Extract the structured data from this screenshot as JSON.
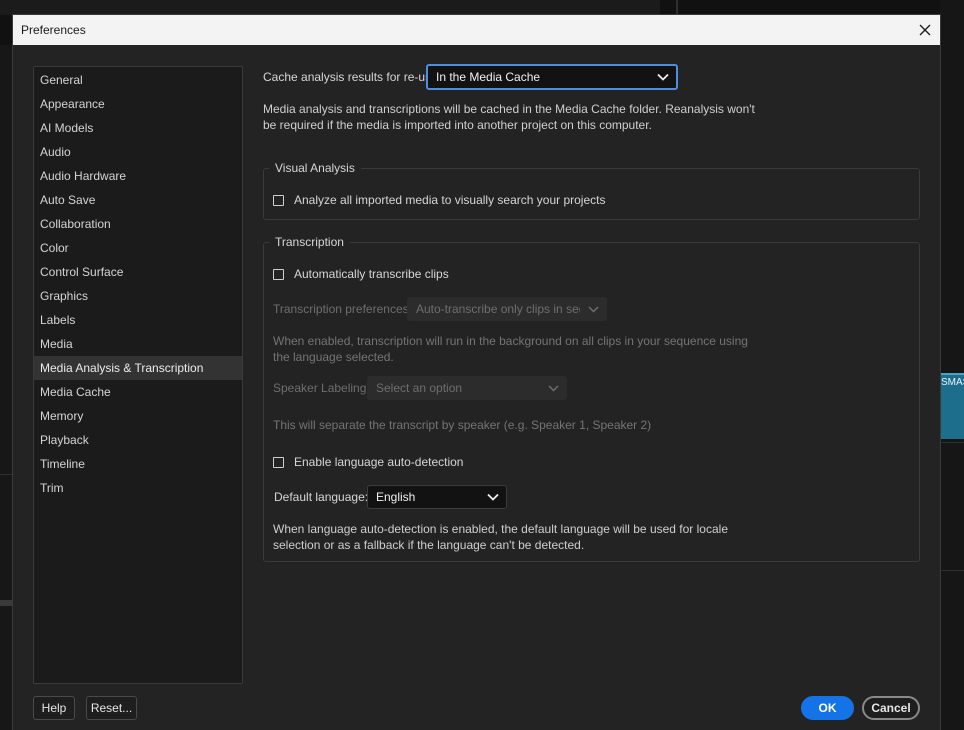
{
  "dialog": {
    "title": "Preferences"
  },
  "sidebar": {
    "items": [
      {
        "label": "General"
      },
      {
        "label": "Appearance"
      },
      {
        "label": "AI Models"
      },
      {
        "label": "Audio"
      },
      {
        "label": "Audio Hardware"
      },
      {
        "label": "Auto Save"
      },
      {
        "label": "Collaboration"
      },
      {
        "label": "Color"
      },
      {
        "label": "Control Surface"
      },
      {
        "label": "Graphics"
      },
      {
        "label": "Labels"
      },
      {
        "label": "Media"
      },
      {
        "label": "Media Analysis & Transcription",
        "selected": true
      },
      {
        "label": "Media Cache"
      },
      {
        "label": "Memory"
      },
      {
        "label": "Playback"
      },
      {
        "label": "Timeline"
      },
      {
        "label": "Trim"
      }
    ]
  },
  "cache": {
    "label": "Cache analysis results for re-use:",
    "value": "In the Media Cache",
    "description_line1": "Media analysis and transcriptions will be cached in the Media Cache folder. Reanalysis won't",
    "description_line2": "be required if the media is imported into another project on this computer."
  },
  "visual_analysis": {
    "title": "Visual Analysis",
    "checkbox_label": "Analyze all imported media to visually search your projects",
    "checked": false
  },
  "transcription": {
    "title": "Transcription",
    "auto_transcribe_label": "Automatically transcribe clips",
    "auto_transcribe_checked": false,
    "preferences_label": "Transcription preferences:",
    "preferences_value": "Auto-transcribe only clips in seq...",
    "preferences_note_line1": "When enabled, transcription will run in the background on all clips in your sequence using",
    "preferences_note_line2": "the language selected.",
    "speaker_label": "Speaker Labeling:",
    "speaker_value": "Select an option",
    "speaker_note": "This will separate the transcript by speaker (e.g. Speaker 1, Speaker 2)",
    "auto_detect_label": "Enable language auto-detection",
    "auto_detect_checked": false,
    "default_language_label": "Default language:",
    "default_language_value": "English",
    "language_note_line1": "When language auto-detection is enabled, the default language will be used for locale",
    "language_note_line2": "selection or as a fallback if the language can't be detected."
  },
  "footer": {
    "help_label": "Help",
    "reset_label": "Reset...",
    "ok_label": "OK",
    "cancel_label": "Cancel"
  },
  "background": {
    "clip_label": "SMAS"
  },
  "colors": {
    "accent": "#1473e6",
    "focus_border": "#4a90e2",
    "dialog_bg": "#232323"
  }
}
